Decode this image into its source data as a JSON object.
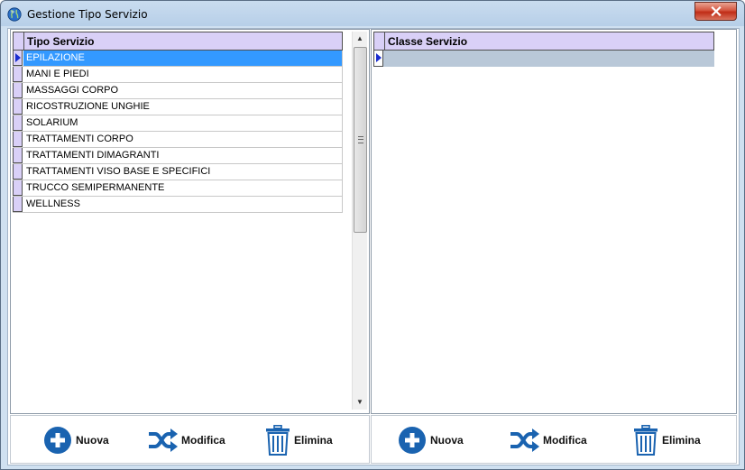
{
  "window": {
    "title": "Gestione Tipo Servizio"
  },
  "left_grid": {
    "header": "Tipo Servizio",
    "rows": [
      "EPILAZIONE",
      "MANI E PIEDI",
      "MASSAGGI CORPO",
      "RICOSTRUZIONE UNGHIE",
      "SOLARIUM",
      "TRATTAMENTI CORPO",
      "TRATTAMENTI DIMAGRANTI",
      "TRATTAMENTI  VISO BASE E SPECIFICI",
      "TRUCCO SEMIPERMANENTE",
      "WELLNESS"
    ],
    "selected_index": 0
  },
  "right_grid": {
    "header": "Classe Servizio"
  },
  "left_toolbar": {
    "new_label": "Nuova",
    "edit_label": "Modifica",
    "delete_label": "Elimina"
  },
  "right_toolbar": {
    "new_label": "Nuova",
    "edit_label": "Modifica",
    "delete_label": "Elimina"
  },
  "colors": {
    "accent": "#1a63b0",
    "selection": "#3399ff",
    "header_bg": "#d9d0f7",
    "close": "#c9462e"
  },
  "icons": [
    "globe-icon",
    "close-icon",
    "plus-icon",
    "shuffle-icon",
    "trash-icon",
    "row-pointer-icon"
  ]
}
